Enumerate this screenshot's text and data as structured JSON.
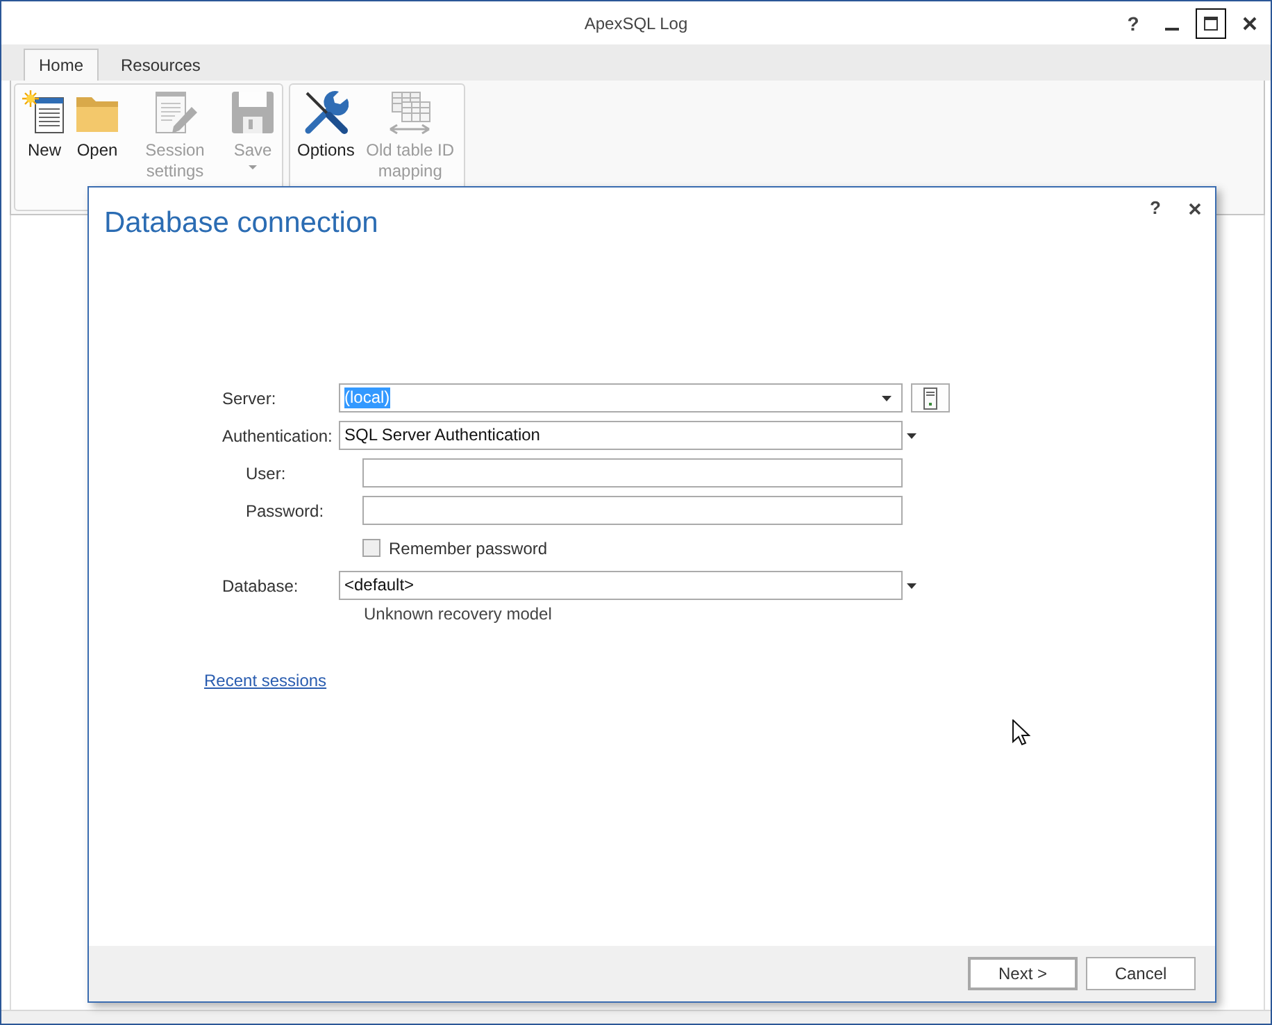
{
  "window": {
    "title": "ApexSQL Log",
    "help": "?"
  },
  "ribbon": {
    "tabs": [
      {
        "label": "Home",
        "selected": true
      },
      {
        "label": "Resources",
        "selected": false
      }
    ],
    "groups": [
      {
        "buttons": [
          {
            "kind": "new",
            "label": "New",
            "disabled": false,
            "dropdown": false
          },
          {
            "kind": "open",
            "label": "Open",
            "disabled": false,
            "dropdown": false
          },
          {
            "kind": "settings",
            "label": "Session settings",
            "disabled": true,
            "dropdown": false
          },
          {
            "kind": "save",
            "label": "Save",
            "disabled": true,
            "dropdown": true
          }
        ]
      },
      {
        "buttons": [
          {
            "kind": "options",
            "label": "Options",
            "disabled": false,
            "dropdown": false
          },
          {
            "kind": "mapping",
            "label": "Old table ID mapping",
            "disabled": true,
            "dropdown": false
          }
        ]
      }
    ]
  },
  "dialog": {
    "title": "Database connection",
    "help": "?",
    "fields": [
      {
        "kind": "combo",
        "label": "Server:",
        "value": "(local)",
        "value_highlighted": true,
        "browse": true
      },
      {
        "kind": "select",
        "label": "Authentication:",
        "value": "SQL Server Authentication",
        "children": [
          {
            "kind": "text",
            "label": "User:"
          },
          {
            "kind": "password",
            "label": "Password:"
          },
          {
            "kind": "checkbox",
            "label": "Remember password",
            "checked": false
          }
        ]
      },
      {
        "kind": "select",
        "label": "Database:",
        "value": "<default>",
        "note": "Unknown recovery model"
      }
    ],
    "link": "Recent sessions",
    "buttons": [
      {
        "label": "Next >",
        "default": true
      },
      {
        "label": "Cancel",
        "default": false
      }
    ]
  }
}
